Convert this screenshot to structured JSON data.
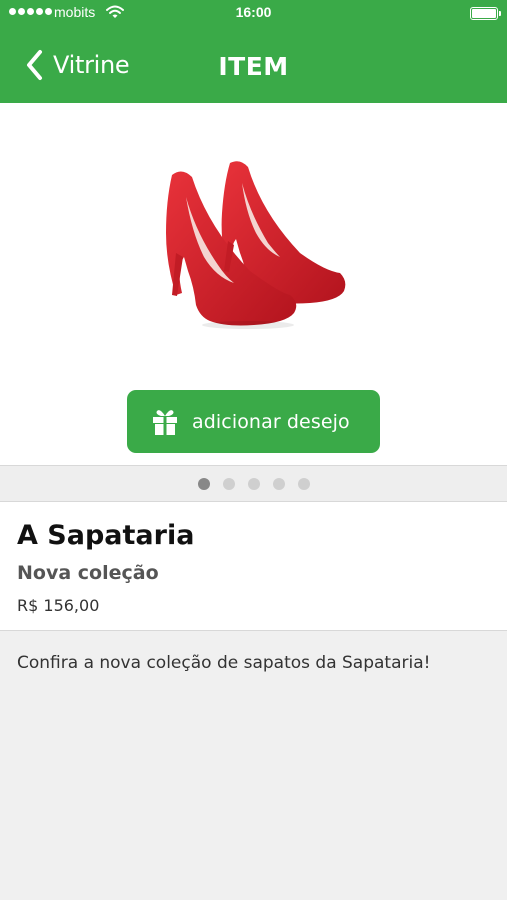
{
  "status_bar": {
    "carrier": "mobits",
    "time": "16:00",
    "signal_icon": "signal-dots-icon",
    "wifi_icon": "wifi-icon",
    "battery_icon": "battery-icon"
  },
  "nav": {
    "back_label": "Vitrine",
    "back_icon": "chevron-left-icon",
    "title": "ITEM"
  },
  "product": {
    "image": "red-high-heels-shoes",
    "wish_button_label": "adicionar desejo",
    "wish_button_icon": "gift-icon",
    "carousel": {
      "total": 5,
      "active": 1
    },
    "store_name": "A Sapataria",
    "collection": "Nova coleção",
    "price": "R$ 156,00",
    "description": "Confira a nova coleção de sapatos da Sapataria!"
  },
  "colors": {
    "brand_green": "#3aaa48",
    "shoe_red": "#d8202a",
    "background": "#f0f0f0"
  }
}
